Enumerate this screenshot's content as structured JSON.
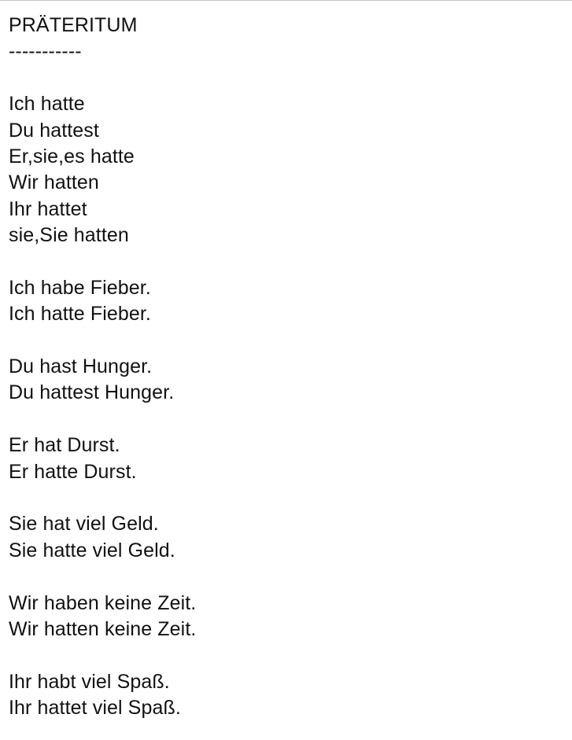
{
  "note": {
    "title": "PRÄTERITUM",
    "underline": "-----------",
    "conjugation": [
      "Ich hatte",
      "Du hattest",
      "Er,sie,es hatte",
      "Wir hatten",
      "Ihr hattet",
      "sie,Sie hatten"
    ],
    "examples": [
      {
        "present": "Ich habe Fieber.",
        "past": "Ich hatte Fieber."
      },
      {
        "present": "Du hast Hunger.",
        "past": "Du hattest Hunger."
      },
      {
        "present": "Er hat Durst.",
        "past": "Er hatte Durst."
      },
      {
        "present": "Sie hat viel Geld.",
        "past": "Sie hatte viel Geld."
      },
      {
        "present": "Wir haben keine Zeit.",
        "past": "Wir hatten keine Zeit."
      },
      {
        "present": "Ihr habt viel Spaß.",
        "past": "Ihr hattet viel Spaß."
      }
    ]
  }
}
